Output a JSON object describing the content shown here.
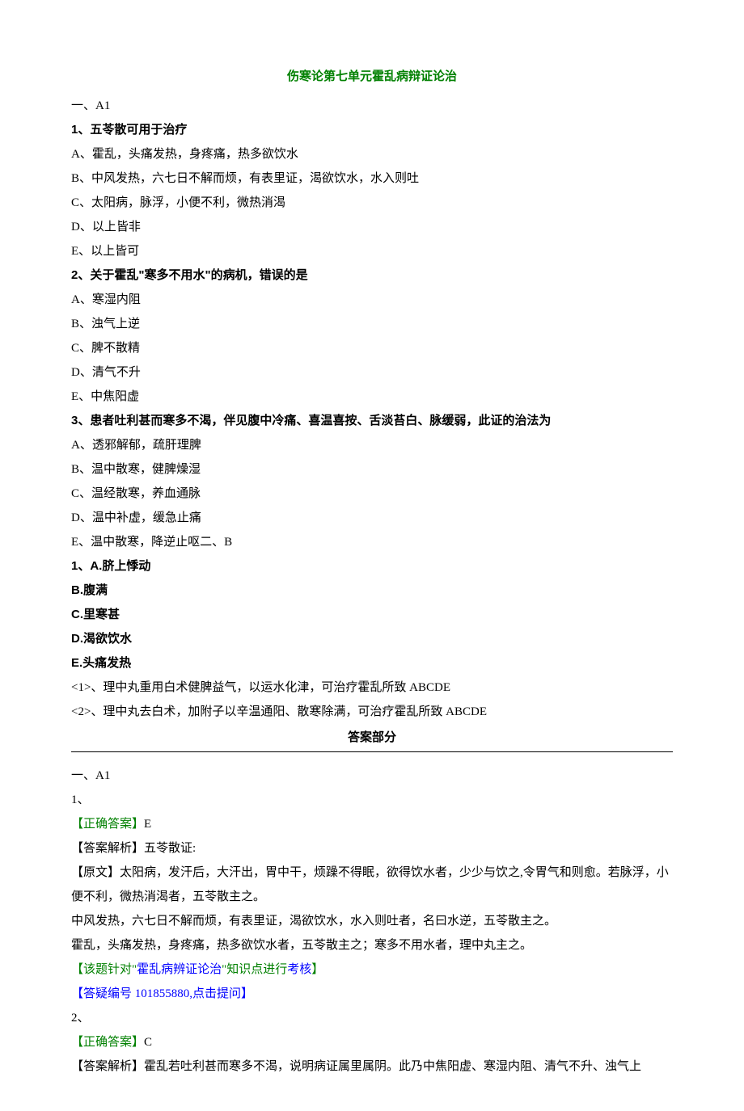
{
  "title": "伤寒论第七单元霍乱病辩证论治",
  "section1": "一、A1",
  "q1": {
    "stem": "1、五苓散可用于治疗",
    "a": "A、霍乱，头痛发热，身疼痛，热多欲饮水",
    "b": "B、中风发热，六七日不解而烦，有表里证，渴欲饮水，水入则吐",
    "c": "C、太阳病，脉浮，小便不利，微热消渴",
    "d": "D、以上皆非",
    "e": "E、以上皆可"
  },
  "q2": {
    "stem": "2、关于霍乱\"寒多不用水\"的病机，错误的是",
    "a": "A、寒湿内阻",
    "b": "B、浊气上逆",
    "c": "C、脾不散精",
    "d": "D、清气不升",
    "e": "E、中焦阳虚"
  },
  "q3": {
    "stem": "3、患者吐利甚而寒多不渴，伴见腹中冷痛、喜温喜按、舌淡苔白、脉缓弱，此证的治法为",
    "a": "A、透邪解郁，疏肝理脾",
    "b": "B、温中散寒，健脾燥湿",
    "c": "C、温经散寒，养血通脉",
    "d": "D、温中补虚，缓急止痛",
    "e": "E、温中散寒，降逆止呕二、B"
  },
  "q4": {
    "a": "1、A.脐上悸动",
    "b": "B.腹满",
    "c": "C.里寒甚",
    "d": "D.渴欲饮水",
    "e": "E.头痛发热",
    "s1": "<1>、理中丸重用白术健脾益气，以运水化津，可治疗霍乱所致 ABCDE",
    "s2": "<2>、理中丸去白术，加附子以辛温通阳、散寒除满，可治疗霍乱所致 ABCDE"
  },
  "answer_header": "答案部分",
  "ans": {
    "sec": "一、A1",
    "a1": {
      "num": "1、",
      "correct_label": "【正确答案】",
      "correct_val": "E",
      "exp_label": "【答案解析】",
      "exp_val": "五苓散证:",
      "p1": "【原文】太阳病，发汗后，大汗出，胃中干，烦躁不得眠，欲得饮水者，少少与饮之,令胃气和则愈。若脉浮，小便不利，微热消渴者，五苓散主之。",
      "p2": "中风发热，六七日不解而烦，有表里证，渴欲饮水，水入则吐者，名曰水逆，五苓散主之。",
      "p3": "霍乱，头痛发热，身疼痛，热多欲饮水者，五苓散主之；寒多不用水者，理中丸主之。",
      "note_pre": "【该题针对\"",
      "note_mid": "霍乱病辨证论治",
      "note_post": "\"知识点进行",
      "note_end": "考核",
      "note_close": "】",
      "faq": "【答疑编号 101855880,点击提问】"
    },
    "a2": {
      "num": "2、",
      "correct_label": "【正确答案】",
      "correct_val": "C",
      "exp_label": "【答案解析】",
      "exp_val": "霍乱若吐利甚而寒多不渴，说明病证属里属阴。此乃中焦阳虚、寒湿内阻、清气不升、浊气上"
    }
  }
}
